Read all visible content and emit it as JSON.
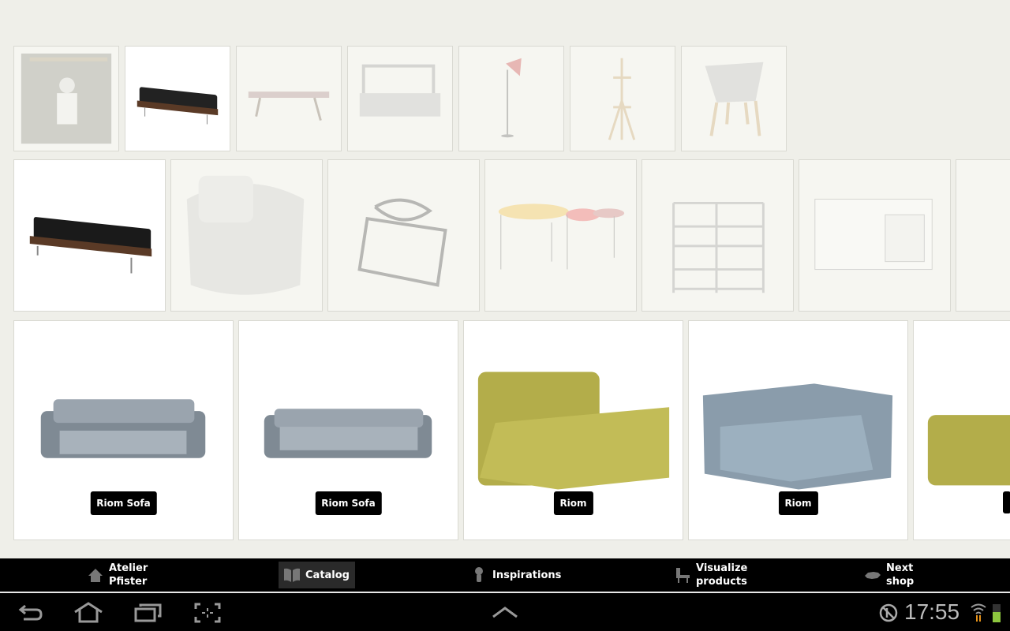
{
  "row1": [
    {
      "name": "photo-person"
    },
    {
      "name": "black-bench-sofa"
    },
    {
      "name": "table"
    },
    {
      "name": "lounge-daybed"
    },
    {
      "name": "floor-lamp"
    },
    {
      "name": "coat-stand"
    },
    {
      "name": "chair"
    }
  ],
  "row2": [
    {
      "name": "black-bench-sofa"
    },
    {
      "name": "armchair"
    },
    {
      "name": "wire-stool"
    },
    {
      "name": "side-tables"
    },
    {
      "name": "shelf"
    },
    {
      "name": "sideboard"
    },
    {
      "name": "partial"
    }
  ],
  "products": [
    {
      "label": "Riom Sofa",
      "color": "#7f8a94"
    },
    {
      "label": "Riom Sofa",
      "color": "#7f8a94"
    },
    {
      "label": "Riom",
      "color": "#b3ad4a"
    },
    {
      "label": "Riom",
      "color": "#8a9cab"
    },
    {
      "label": "",
      "color": "#b3ad4a"
    }
  ],
  "nav": [
    {
      "label1": "Atelier",
      "label2": "Pfister",
      "icon": "home-icon"
    },
    {
      "label1": "Catalog",
      "icon": "book-icon",
      "active": true
    },
    {
      "label1": "Inspirations",
      "icon": "bulb-icon"
    },
    {
      "label1": "Visualize",
      "label2": "products",
      "icon": "chair-icon"
    },
    {
      "label1": "Next",
      "label2": "shop",
      "icon": "switzerland-map-icon"
    }
  ],
  "status": {
    "time": "17:55"
  },
  "colors": {
    "background": "#efefe9",
    "navbar": "#000000",
    "battery": "#8dc63f"
  }
}
